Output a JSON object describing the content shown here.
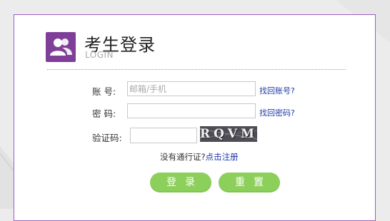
{
  "colors": {
    "accent": "#7f3f98",
    "border": "#9a5fbf",
    "button_green": "#8ccf5a",
    "link_blue": "#1f3aa8",
    "background": "#ececec"
  },
  "header": {
    "icon": "users-icon",
    "title": "考生登录",
    "subtitle": "LOGIN"
  },
  "form": {
    "account": {
      "label": "账  号:",
      "placeholder": "邮箱/手机",
      "value": "",
      "link": "找回账号?"
    },
    "password": {
      "label": "密  码:",
      "value": "",
      "link": "找回密码?"
    },
    "captcha": {
      "label": "验证码:",
      "value": "",
      "image_text": "RQVM"
    }
  },
  "register": {
    "prompt": "没有通行证?",
    "link": "点击注册"
  },
  "buttons": {
    "login": "登录",
    "reset": "重置"
  }
}
